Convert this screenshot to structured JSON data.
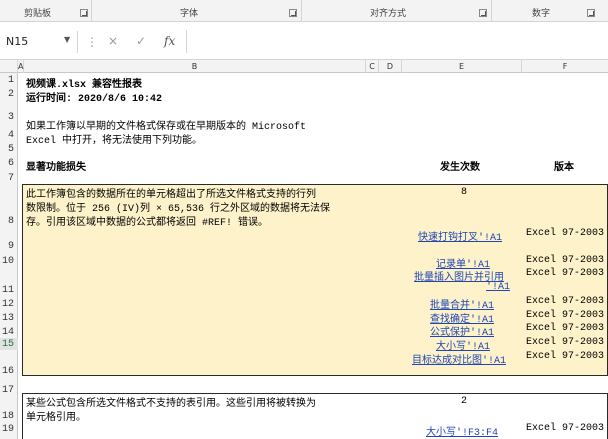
{
  "ribbon": {
    "groups": [
      "剪贴板",
      "字体",
      "对齐方式",
      "数字"
    ]
  },
  "formula_bar": {
    "name_box": "N15",
    "cancel_icon": "×",
    "enter_icon": "✓",
    "fx_icon": "fx",
    "formula": ""
  },
  "columns": [
    "A",
    "B",
    "C",
    "D",
    "E",
    "F"
  ],
  "rows": [
    "1",
    "2",
    "3",
    "4",
    "5",
    "6",
    "7",
    "8",
    "9",
    "10",
    "11",
    "12",
    "13",
    "14",
    "15",
    "16",
    "17",
    "18",
    "19"
  ],
  "report": {
    "title": "视频课.xlsx 兼容性报表",
    "run_time": "运行时间: 2020/8/6 10:42",
    "intro_line1": "如果工作簿以早期的文件格式保存或在早期版本的 Microsoft",
    "intro_line2": "Excel 中打开，将无法使用下列功能。",
    "header_loss": "显著功能损失",
    "header_count": "发生次数",
    "header_version": "版本",
    "issue1": {
      "line1": "此工作簿包含的数据所在的单元格超出了所选文件格式支持的行列",
      "line2": "数限制。位于 256 (IV)列 × 65,536 行之外区域的数据将无法保",
      "line3": "存。引用该区域中数据的公式都将返回 #REF! 错误。",
      "count": "8",
      "refs": [
        {
          "link": "快速打钩打叉'!A1",
          "version": "Excel 97-2003"
        },
        {
          "link": "记录单'!A1",
          "version": "Excel 97-2003"
        },
        {
          "link": "批量插入图片并引用",
          "version": "Excel 97-2003"
        },
        {
          "link": "'!A1",
          "version": ""
        },
        {
          "link": "批量合并'!A1",
          "version": "Excel 97-2003"
        },
        {
          "link": "查找确定'!A1",
          "version": "Excel 97-2003"
        },
        {
          "link": "公式保护'!A1",
          "version": "Excel 97-2003"
        },
        {
          "link": "大小写'!A1",
          "version": "Excel 97-2003"
        },
        {
          "link": "目标达成对比图'!A1",
          "version": "Excel 97-2003"
        }
      ]
    },
    "issue2": {
      "line1": "某些公式包含所选文件格式不支持的表引用。这些引用将被转换为",
      "line2": "单元格引用。",
      "count": "2",
      "refs": [
        {
          "link": "大小写'!F3:F4",
          "version": "Excel 97-2003"
        }
      ]
    }
  }
}
